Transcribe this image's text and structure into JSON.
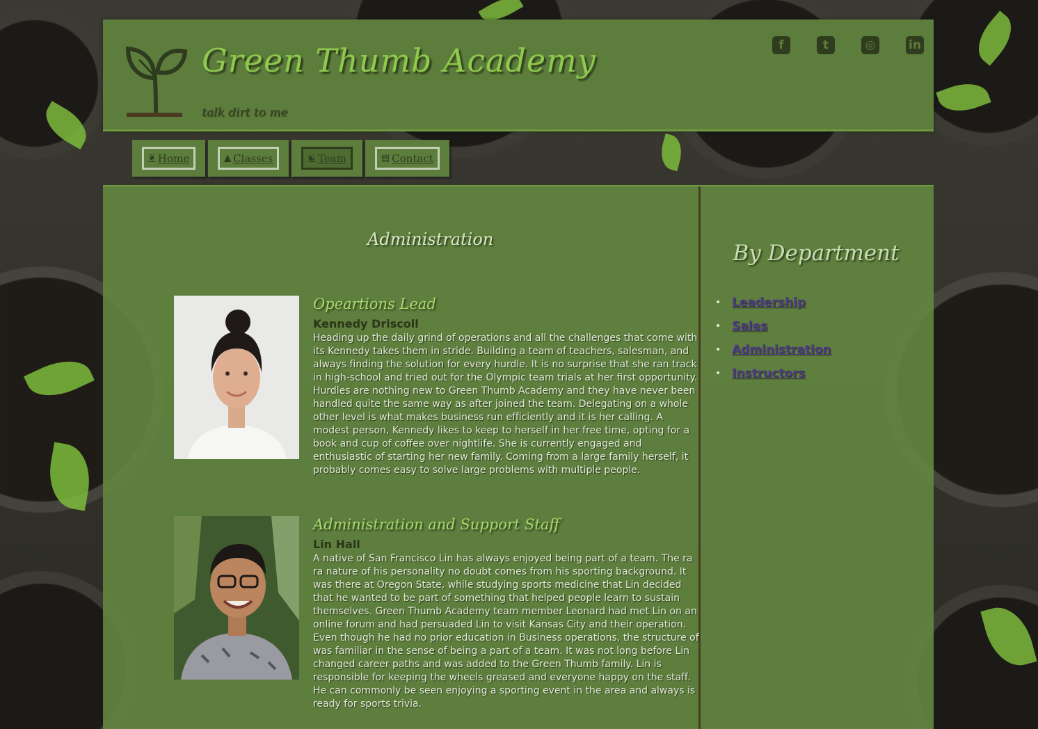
{
  "header": {
    "title": "Green Thumb Academy",
    "tagline": "talk dirt to me",
    "social": [
      {
        "name": "facebook-icon",
        "glyph": "f"
      },
      {
        "name": "twitter-icon",
        "glyph": "t"
      },
      {
        "name": "instagram-icon",
        "glyph": "◎"
      },
      {
        "name": "linkedin-icon",
        "glyph": "in"
      }
    ]
  },
  "nav": {
    "home": "Home",
    "classes": "Classes",
    "team": "Team",
    "contact": "Contact"
  },
  "main": {
    "section_title": "Administration",
    "profiles": [
      {
        "role": "Opeartions Lead",
        "name": "Kennedy Driscoll",
        "bio": "Heading up the daily grind of operations and all the challenges that come with its Kennedy takes them in stride. Building a team of teachers, salesman, and always finding the solution for every hurdle. It is no surprise that she ran track in high-school and tried out for the Olympic team trials at her first opportunity. Hurdles are nothing new to Green Thumb Academy and they have never been handled quite the same way as after joined the team. Delegating on a whole other level is what makes business run efficiently and it is her calling. A modest person, Kennedy likes to keep to herself in her free time, opting for a book and cup of coffee over nightlife. She is currently engaged and enthusiastic of starting her new family. Coming from a large family herself, it probably comes easy to solve large problems with multiple people."
      },
      {
        "role": "Administration and Support Staff",
        "name": "Lin Hall",
        "bio": "A native of San Francisco Lin has always enjoyed being part of a team. The ra ra nature of his personality no doubt comes from his sporting background. It was there at Oregon State, while studying sports medicine that Lin decided that he wanted to be part of something that helped people learn to sustain themselves. Green Thumb Academy team member Leonard had met Lin on an online forum and had persuaded Lin to visit Kansas City and their operation. Even though he had no prior education in Business operations, the structure of was familiar in the sense of being a part of a team. It was not long before Lin changed career paths and was added to the Green Thumb family. Lin is responsible for keeping the wheels greased and everyone happy on the staff. He can commonly be seen enjoying a sporting event in the area and always is ready for sports trivia."
      }
    ]
  },
  "sidebar": {
    "title": "By Department",
    "items": [
      "Leadership",
      "Sales",
      "Administration",
      "Instructors"
    ]
  },
  "colors": {
    "panel": "#5d7d3d",
    "accent": "#8fca4c",
    "link": "#4e3b86",
    "divider": "#4b3b22"
  }
}
